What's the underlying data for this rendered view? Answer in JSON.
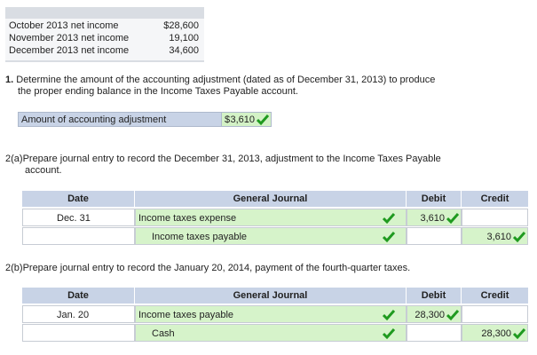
{
  "income": {
    "rows": [
      {
        "label": "October 2013 net income",
        "amount": "$28,600"
      },
      {
        "label": "November 2013 net income",
        "amount": "19,100"
      },
      {
        "label": "December 2013 net income",
        "amount": "34,600"
      }
    ]
  },
  "q1": {
    "number": "1.",
    "text_line1": "Determine the amount of the accounting adjustment (dated as of December 31, 2013) to produce",
    "text_line2": "the proper ending balance in the Income Taxes Payable account.",
    "adjustment_label": "Amount of accounting adjustment",
    "currency": "$",
    "adjustment_value": "3,610"
  },
  "q2a": {
    "number": "2(a)",
    "text_line1": "Prepare journal entry to record the December 31, 2013, adjustment to the Income Taxes Payable",
    "text_line2": "account.",
    "headers": {
      "date": "Date",
      "journal": "General Journal",
      "debit": "Debit",
      "credit": "Credit"
    },
    "rows": [
      {
        "date": "Dec. 31",
        "account": "Income taxes expense",
        "debit": "3,610",
        "credit": ""
      },
      {
        "date": "",
        "account": "Income taxes payable",
        "debit": "",
        "credit": "3,610"
      }
    ]
  },
  "q2b": {
    "number": "2(b)",
    "text_line1": "Prepare journal entry to record the January 20, 2014, payment of the fourth-quarter taxes.",
    "headers": {
      "date": "Date",
      "journal": "General Journal",
      "debit": "Debit",
      "credit": "Credit"
    },
    "rows": [
      {
        "date": "Jan. 20",
        "account": "Income taxes payable",
        "debit": "28,300",
        "credit": ""
      },
      {
        "date": "",
        "account": "Cash",
        "debit": "",
        "credit": "28,300"
      }
    ]
  },
  "colors": {
    "header_blue": "#c8d3e6",
    "correct_green": "#d6f3ca",
    "check_green": "#1f9a1f"
  }
}
